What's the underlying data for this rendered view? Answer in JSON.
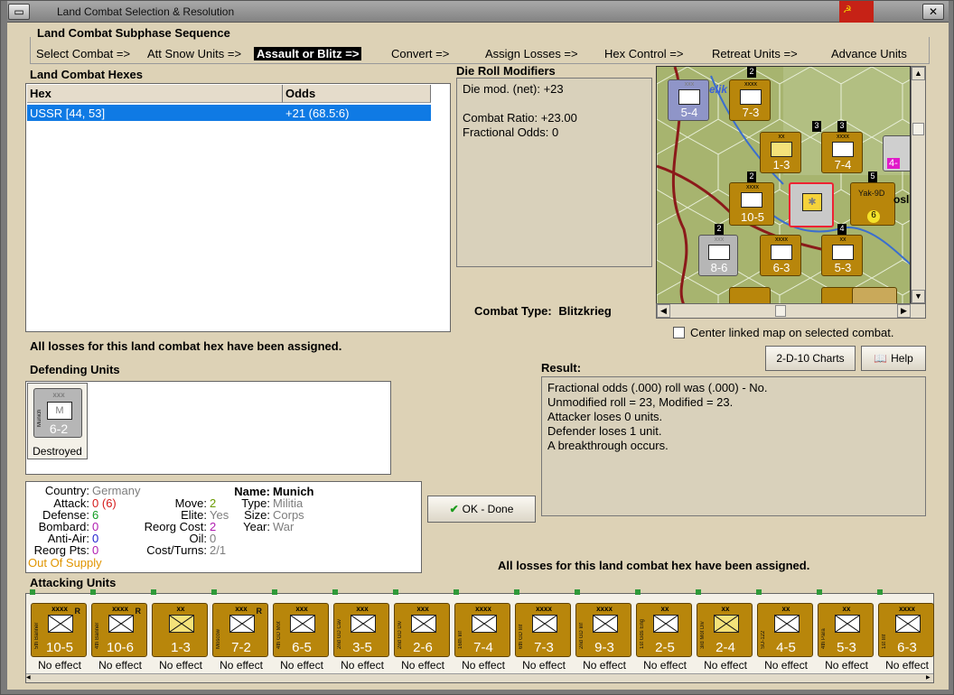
{
  "window": {
    "title": "Land Combat Selection & Resolution",
    "flag": "☭"
  },
  "subphase": {
    "header": "Land Combat Subphase Sequence",
    "steps": [
      "Select Combat =>",
      "Att Snow Units =>",
      "Assault or Blitz =>",
      "Convert =>",
      "Assign Losses =>",
      "Hex Control =>",
      "Retreat Units =>",
      "Advance Units"
    ]
  },
  "hexes": {
    "header": "Land Combat Hexes",
    "columns": [
      "Hex",
      "Odds"
    ],
    "rows": [
      {
        "hex": "USSR [44, 53]",
        "odds": "+21 (68.5:6)"
      }
    ]
  },
  "modifiers": {
    "header": "Die Roll Modifiers",
    "lines": [
      "Die mod. (net): +23",
      "",
      "Combat Ratio: +23.00",
      "Fractional Odds: 0"
    ]
  },
  "combat_type": {
    "label": "Combat Type:",
    "value": "Blitzkrieg"
  },
  "center_map_label": "Center linked map on selected combat.",
  "losses_msg": "All losses for this land combat hex have been assigned.",
  "losses_msg2": "All losses for this land combat hex have been assigned.",
  "buttons": {
    "charts": "2-D-10 Charts",
    "help": "Help",
    "ok": "OK - Done"
  },
  "result": {
    "header": "Result:",
    "lines": [
      "Fractional odds (.000) roll was (.000)  - No.",
      "Unmodified roll = 23, Modified = 23.",
      "Attacker loses 0 units.",
      "Defender loses 1 unit.",
      "A breakthrough occurs."
    ]
  },
  "defending": {
    "header": "Defending Units",
    "unit": {
      "size": "xxx",
      "name": "Munich",
      "symbol": "M",
      "strength": "6-2",
      "status": "Destroyed"
    }
  },
  "unit_info": {
    "country_label": "Country:",
    "country": "Germany",
    "attack_label": "Attack:",
    "attack": "0",
    "attack_extra": "(6)",
    "defense_label": "Defense:",
    "defense": "6",
    "bombard_label": "Bombard:",
    "bombard": "0",
    "antiair_label": "Anti-Air:",
    "antiair": "0",
    "reorg_label": "Reorg Pts:",
    "reorg": "0",
    "supply": "Out Of Supply",
    "move_label": "Move:",
    "move": "2",
    "elite_label": "Elite:",
    "elite": "Yes",
    "reorgcost_label": "Reorg Cost:",
    "reorgcost": "2",
    "oil_label": "Oil:",
    "oil": "0",
    "costturns_label": "Cost/Turns:",
    "costturns": "2/1",
    "name_label": "Name:",
    "name": "Munich",
    "type_label": "Type:",
    "type": "Militia",
    "size_label": "Size:",
    "size": "Corps",
    "year_label": "Year:",
    "year": "War"
  },
  "attacking": {
    "header": "Attacking Units",
    "units": [
      {
        "name": "5th Banner",
        "size": "xxxx",
        "strength": "10-5",
        "status": "No effect",
        "r": "R"
      },
      {
        "name": "4th Banner",
        "size": "xxxx",
        "strength": "10-6",
        "status": "No effect",
        "r": "R"
      },
      {
        "name": "",
        "size": "xx",
        "strength": "1-3",
        "status": "No effect",
        "r": ""
      },
      {
        "name": "Moscow",
        "size": "xxx",
        "strength": "7-2",
        "status": "No effect",
        "r": "R"
      },
      {
        "name": "4th GD Mot",
        "size": "xxx",
        "strength": "6-5",
        "status": "No effect",
        "r": ""
      },
      {
        "name": "2nd GD Cav",
        "size": "xxx",
        "strength": "3-5",
        "status": "No effect",
        "r": ""
      },
      {
        "name": "2nd GD Div",
        "size": "xxx",
        "strength": "2-6",
        "status": "No effect",
        "r": ""
      },
      {
        "name": "16th Inf",
        "size": "xxxx",
        "strength": "7-4",
        "status": "No effect",
        "r": ""
      },
      {
        "name": "6th GD Inf",
        "size": "xxxx",
        "strength": "7-3",
        "status": "No effect",
        "r": ""
      },
      {
        "name": "2nd GD Inf",
        "size": "xxxx",
        "strength": "9-3",
        "status": "No effect",
        "r": ""
      },
      {
        "name": "1st Gds Eng",
        "size": "xx",
        "strength": "2-5",
        "status": "No effect",
        "r": ""
      },
      {
        "name": "3rd Mot Div",
        "size": "xx",
        "strength": "2-4",
        "status": "No effect",
        "r": ""
      },
      {
        "name": "SU-122",
        "size": "xx",
        "strength": "4-5",
        "status": "No effect",
        "r": ""
      },
      {
        "name": "4th Para",
        "size": "xx",
        "strength": "5-3",
        "status": "No effect",
        "r": ""
      },
      {
        "name": "1st Inf",
        "size": "xxxx",
        "strength": "6-3",
        "status": "No effect",
        "r": ""
      }
    ]
  },
  "map": {
    "counters": [
      {
        "strength": "5-4",
        "size": "xxx"
      },
      {
        "strength": "7-3",
        "size": "xxxx"
      },
      {
        "strength": "1-3",
        "size": "xx"
      },
      {
        "strength": "7-4",
        "size": "xxxx"
      },
      {
        "strength": "4-",
        "size": ""
      },
      {
        "strength": "10-5",
        "size": "xxxx"
      },
      {
        "strength": "Yak-9D",
        "size": ""
      },
      {
        "strength": "8-6",
        "size": "xxx"
      },
      {
        "strength": "6-3",
        "size": "xxxx"
      },
      {
        "strength": "5-3",
        "size": "xx"
      }
    ],
    "map_labels": [
      "elik",
      "osl"
    ],
    "stack_numbers": [
      "2",
      "3",
      "3",
      "2",
      "5",
      "2",
      "4"
    ]
  }
}
